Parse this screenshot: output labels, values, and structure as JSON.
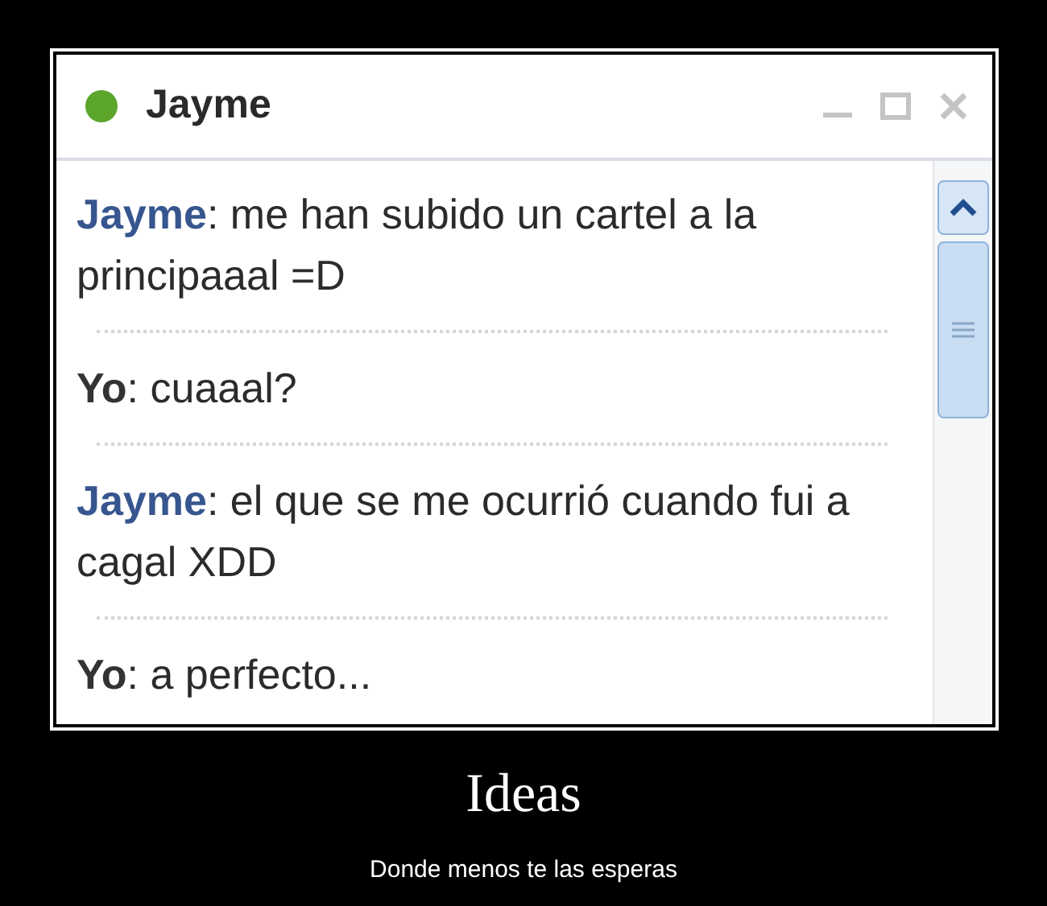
{
  "window": {
    "title": "Jayme",
    "online": true
  },
  "messages": [
    {
      "sender": "Jayme",
      "kind": "contact",
      "text": ": me han subido un cartel a la principaaal =D"
    },
    {
      "sender": "Yo",
      "kind": "self",
      "text": ": cuaaal?"
    },
    {
      "sender": "Jayme",
      "kind": "contact",
      "text": ": el que se me ocurrió cuando fui a cagal XDD"
    },
    {
      "sender": "Yo",
      "kind": "self",
      "text": ": a perfecto..."
    }
  ],
  "poster": {
    "title": "Ideas",
    "subtitle": "Donde menos te las esperas"
  }
}
